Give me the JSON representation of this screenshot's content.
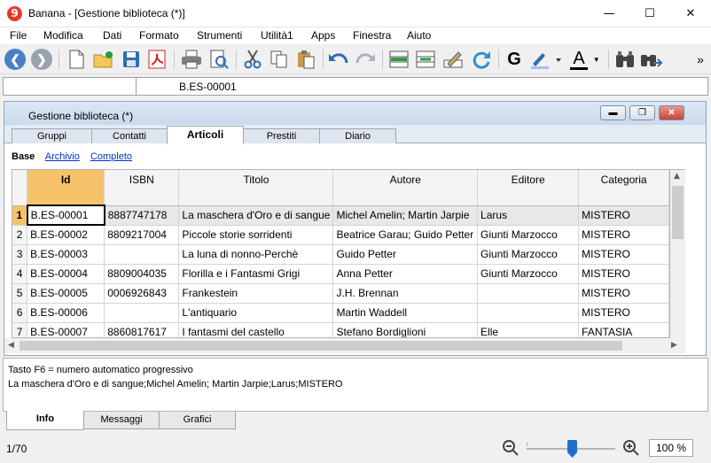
{
  "window": {
    "title": "Banana - [Gestione biblioteca (*)]",
    "app_icon_glyph": "9"
  },
  "menu": [
    "File",
    "Modifica",
    "Dati",
    "Formato",
    "Strumenti",
    "Utilità1",
    "Apps",
    "Finestra",
    "Aiuto"
  ],
  "toolbar": {
    "overflow": "»",
    "bold_glyph": "G",
    "text_color_glyph": "A"
  },
  "cellbar": {
    "address": "",
    "value": "B.ES-00001"
  },
  "document": {
    "title": "Gestione biblioteca (*)",
    "tabs": [
      "Gruppi",
      "Contatti",
      "Articoli",
      "Prestiti",
      "Diario"
    ],
    "active_tab": "Articoli",
    "views": [
      "Base",
      "Archivio",
      "Completo"
    ],
    "active_view": "Base",
    "columns": [
      "Id",
      "ISBN",
      "Titolo",
      "Autore",
      "Editore",
      "Categoria"
    ],
    "rows": [
      {
        "n": "1",
        "cells": [
          "B.ES-00001",
          "8887747178",
          "La maschera d'Oro e di sangue",
          "Michel Amelin; Martin Jarpie",
          "Larus",
          "MISTERO"
        ]
      },
      {
        "n": "2",
        "cells": [
          "B.ES-00002",
          "8809217004",
          "Piccole storie sorridenti",
          "Beatrice Garau; Guido Petter",
          "Giunti Marzocco",
          "MISTERO"
        ]
      },
      {
        "n": "3",
        "cells": [
          "B.ES-00003",
          "",
          "La luna di nonno-Perchè",
          "Guido Petter",
          "Giunti Marzocco",
          "MISTERO"
        ]
      },
      {
        "n": "4",
        "cells": [
          "B.ES-00004",
          "8809004035",
          "Florilla e i Fantasmi Grigi",
          "Anna Petter",
          "Giunti Marzocco",
          "MISTERO"
        ]
      },
      {
        "n": "5",
        "cells": [
          "B.ES-00005",
          "0006926843",
          "Frankestein",
          "J.H. Brennan",
          "",
          "MISTERO"
        ]
      },
      {
        "n": "6",
        "cells": [
          "B.ES-00006",
          "",
          "L'antiquario",
          "Martin Waddell",
          "",
          "MISTERO"
        ]
      },
      {
        "n": "7",
        "cells": [
          "B.ES-00007",
          "8860817617",
          "I fantasmi del castello",
          "Stefano Bordiglioni",
          "Elle",
          "FANTASIA"
        ]
      }
    ]
  },
  "info": {
    "line1": "Tasto F6 = numero automatico progressivo",
    "line2": "La maschera d'Oro e di sangue;Michel Amelin; Martin Jarpie;Larus;MISTERO"
  },
  "bottom_tabs": [
    "Info",
    "Messaggi",
    "Grafici"
  ],
  "status": {
    "record_count": "1/70",
    "zoom": "100 %"
  },
  "colors": {
    "selection_header": "#f7c36a",
    "link": "#0033cc",
    "nav_button": "#4a7fc8"
  }
}
